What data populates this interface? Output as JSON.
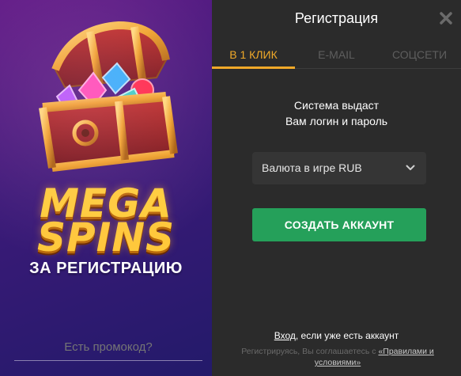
{
  "promo": {
    "title_line1": "MEGA",
    "title_line2": "SPINS",
    "subtitle": "ЗА РЕГИСТРАЦИЮ",
    "promo_code_placeholder": "Есть промокод?"
  },
  "modal": {
    "title": "Регистрация",
    "close_icon": "close-icon"
  },
  "tabs": [
    {
      "label": "В 1 КЛИК",
      "active": true
    },
    {
      "label": "E-MAIL",
      "active": false
    },
    {
      "label": "СОЦСЕТИ",
      "active": false
    }
  ],
  "info": {
    "line1": "Система выдаст",
    "line2": "Вам логин и пароль"
  },
  "currency": {
    "selected": "Валюта в игре RUB",
    "icon": "chevron-down-icon"
  },
  "actions": {
    "create_account": "СОЗДАТЬ АККАУНТ"
  },
  "footer": {
    "login_link": "Вход",
    "login_suffix": ", если уже есть аккаунт",
    "terms_prefix": "Регистрируясь, Вы соглашаетесь с ",
    "terms_link": "«Правилами и условиями»"
  },
  "colors": {
    "accent": "#f0a929",
    "button_green": "#25a05a",
    "panel_bg": "#2b2b2b",
    "promo_bg_top": "#5e1a86",
    "promo_bg_bottom": "#231a6a"
  }
}
